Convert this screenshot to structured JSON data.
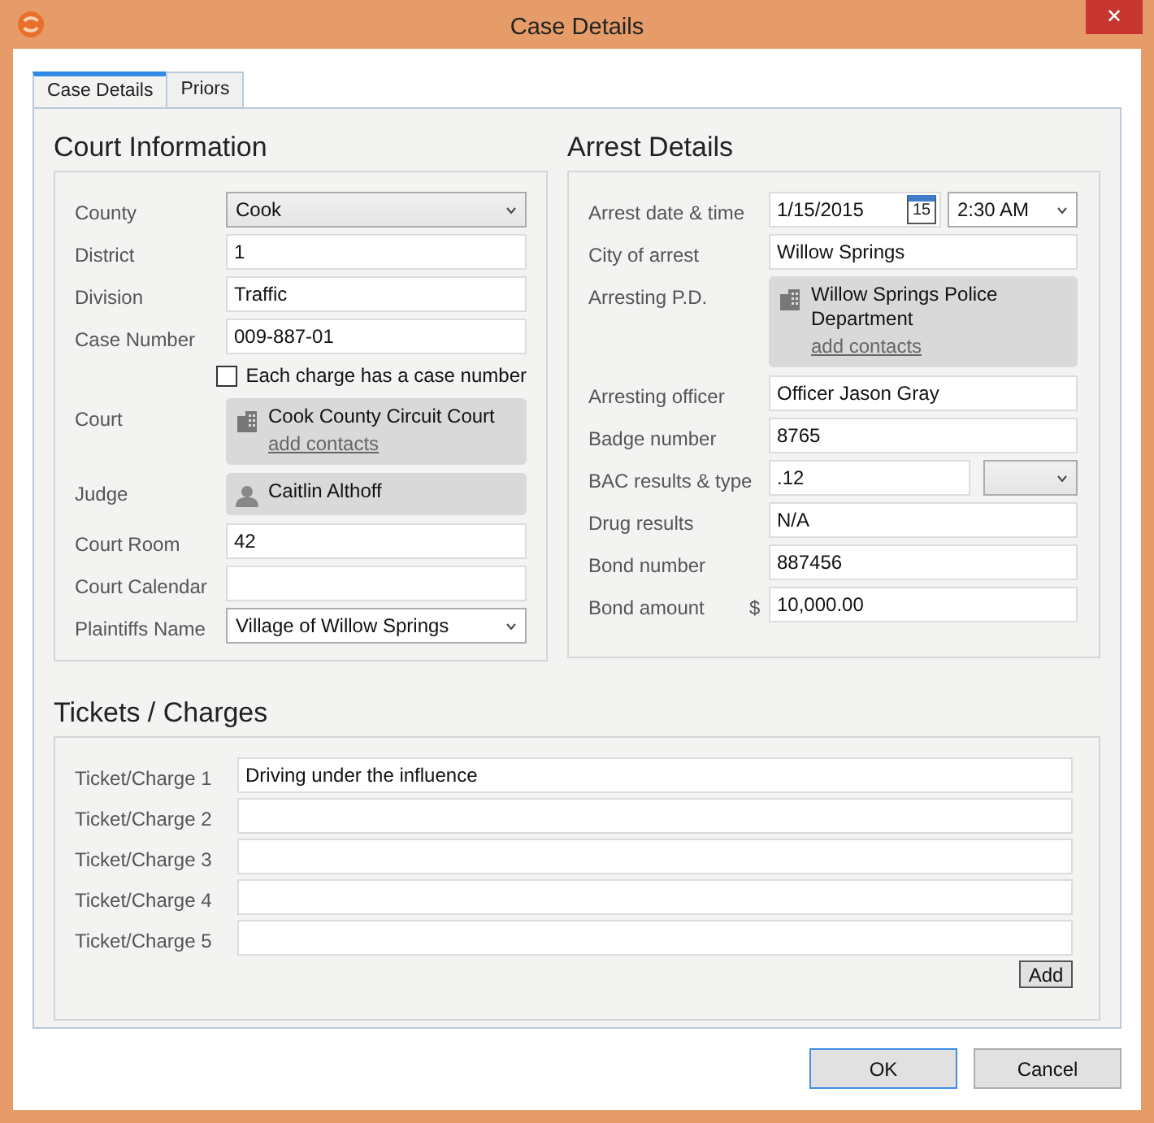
{
  "window": {
    "title": "Case Details",
    "close": "✕"
  },
  "tabs": [
    {
      "label": "Case Details",
      "selected": true
    },
    {
      "label": "Priors",
      "selected": false
    }
  ],
  "court": {
    "title": "Court Information",
    "fields": [
      {
        "kind": "dropdown",
        "label": "County",
        "value": "Cook"
      },
      {
        "kind": "text",
        "label": "District",
        "value": "1"
      },
      {
        "kind": "text",
        "label": "Division",
        "value": "Traffic"
      },
      {
        "kind": "text",
        "label": "Case Number",
        "value": "009-887-01"
      },
      {
        "kind": "checkbox",
        "label": "Each charge has a case number",
        "checked": false
      },
      {
        "kind": "organization",
        "label": "Court",
        "name": "Cook County Circuit Court",
        "link": "add contacts"
      },
      {
        "kind": "person",
        "label": "Judge",
        "name": "Caitlin Althoff"
      },
      {
        "kind": "text",
        "label": "Court Room",
        "value": "42"
      },
      {
        "kind": "text",
        "label": "Court Calendar"
      },
      {
        "kind": "combo",
        "label": "Plaintiffs Name",
        "value": "Village of Willow Springs"
      }
    ]
  },
  "arrest": {
    "title": "Arrest Details",
    "fields": [
      {
        "kind": "datetime",
        "label": "Arrest date & time",
        "date": "1/15/2015",
        "calendar_day": "15",
        "time": "2:30 AM"
      },
      {
        "kind": "text",
        "label": "City of arrest",
        "value": "Willow Springs"
      },
      {
        "kind": "organization",
        "label": "Arresting P.D.",
        "name": "Willow Springs Police Department",
        "link": "add contacts"
      },
      {
        "kind": "text",
        "label": "Arresting officer",
        "value": "Officer Jason Gray"
      },
      {
        "kind": "text",
        "label": "Badge number",
        "value": "8765"
      },
      {
        "kind": "text-select",
        "label": "BAC results & type",
        "value": ".12"
      },
      {
        "kind": "text",
        "label": "Drug results",
        "value": "N/A"
      },
      {
        "kind": "text",
        "label": "Bond number",
        "value": "887456"
      },
      {
        "kind": "currency",
        "label": "Bond amount",
        "prefix": "$",
        "value": "10,000.00"
      }
    ]
  },
  "tickets": {
    "title": "Tickets / Charges",
    "rows": [
      {
        "label": "Ticket/Charge 1",
        "value": "Driving under the influence"
      },
      {
        "label": "Ticket/Charge 2"
      },
      {
        "label": "Ticket/Charge 3"
      },
      {
        "label": "Ticket/Charge 4"
      },
      {
        "label": "Ticket/Charge 5"
      }
    ],
    "add": "Add"
  },
  "buttons": [
    {
      "label": "OK",
      "default": true
    },
    {
      "label": "Cancel",
      "default": false
    }
  ]
}
